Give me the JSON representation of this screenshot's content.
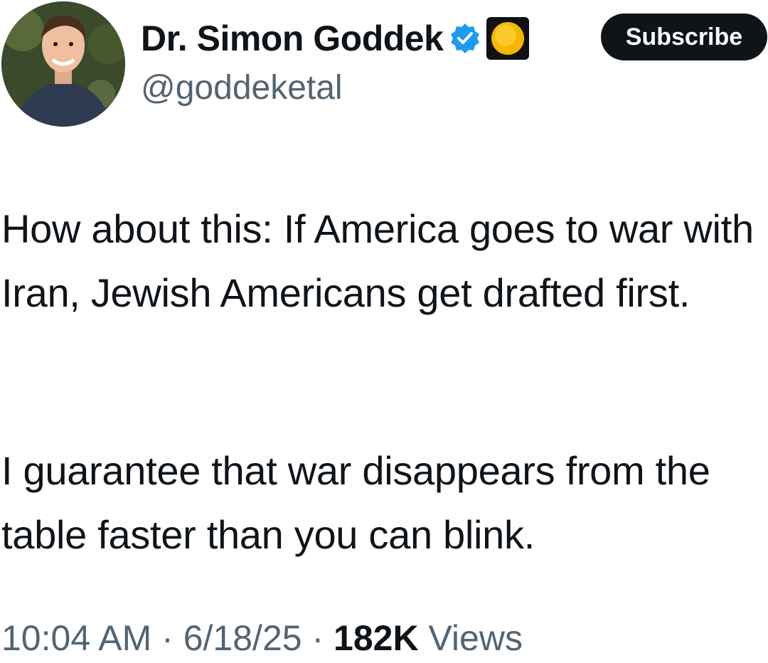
{
  "author": {
    "display_name": "Dr. Simon Goddek",
    "handle": "@goddeketal",
    "avatar_icon": "profile-photo",
    "verified_icon": "verified-badge-icon",
    "affiliate_icon": "affiliate-badge-icon"
  },
  "subscribe": {
    "label": "Subscribe"
  },
  "tweet": {
    "paragraph_1": "How about this: If America goes to war with Iran, Jewish Americans get drafted first.",
    "paragraph_2": "I guarantee that war disappears from the table faster than you can blink."
  },
  "meta": {
    "time": "10:04 AM",
    "date": "6/18/25",
    "separator": "·",
    "views_count": "182K",
    "views_label": "Views"
  },
  "colors": {
    "text": "#0f1419",
    "secondary": "#536471",
    "verified_blue": "#1d9bf0",
    "button_bg": "#0f1419",
    "affiliate_yellow": "#f5b800"
  }
}
